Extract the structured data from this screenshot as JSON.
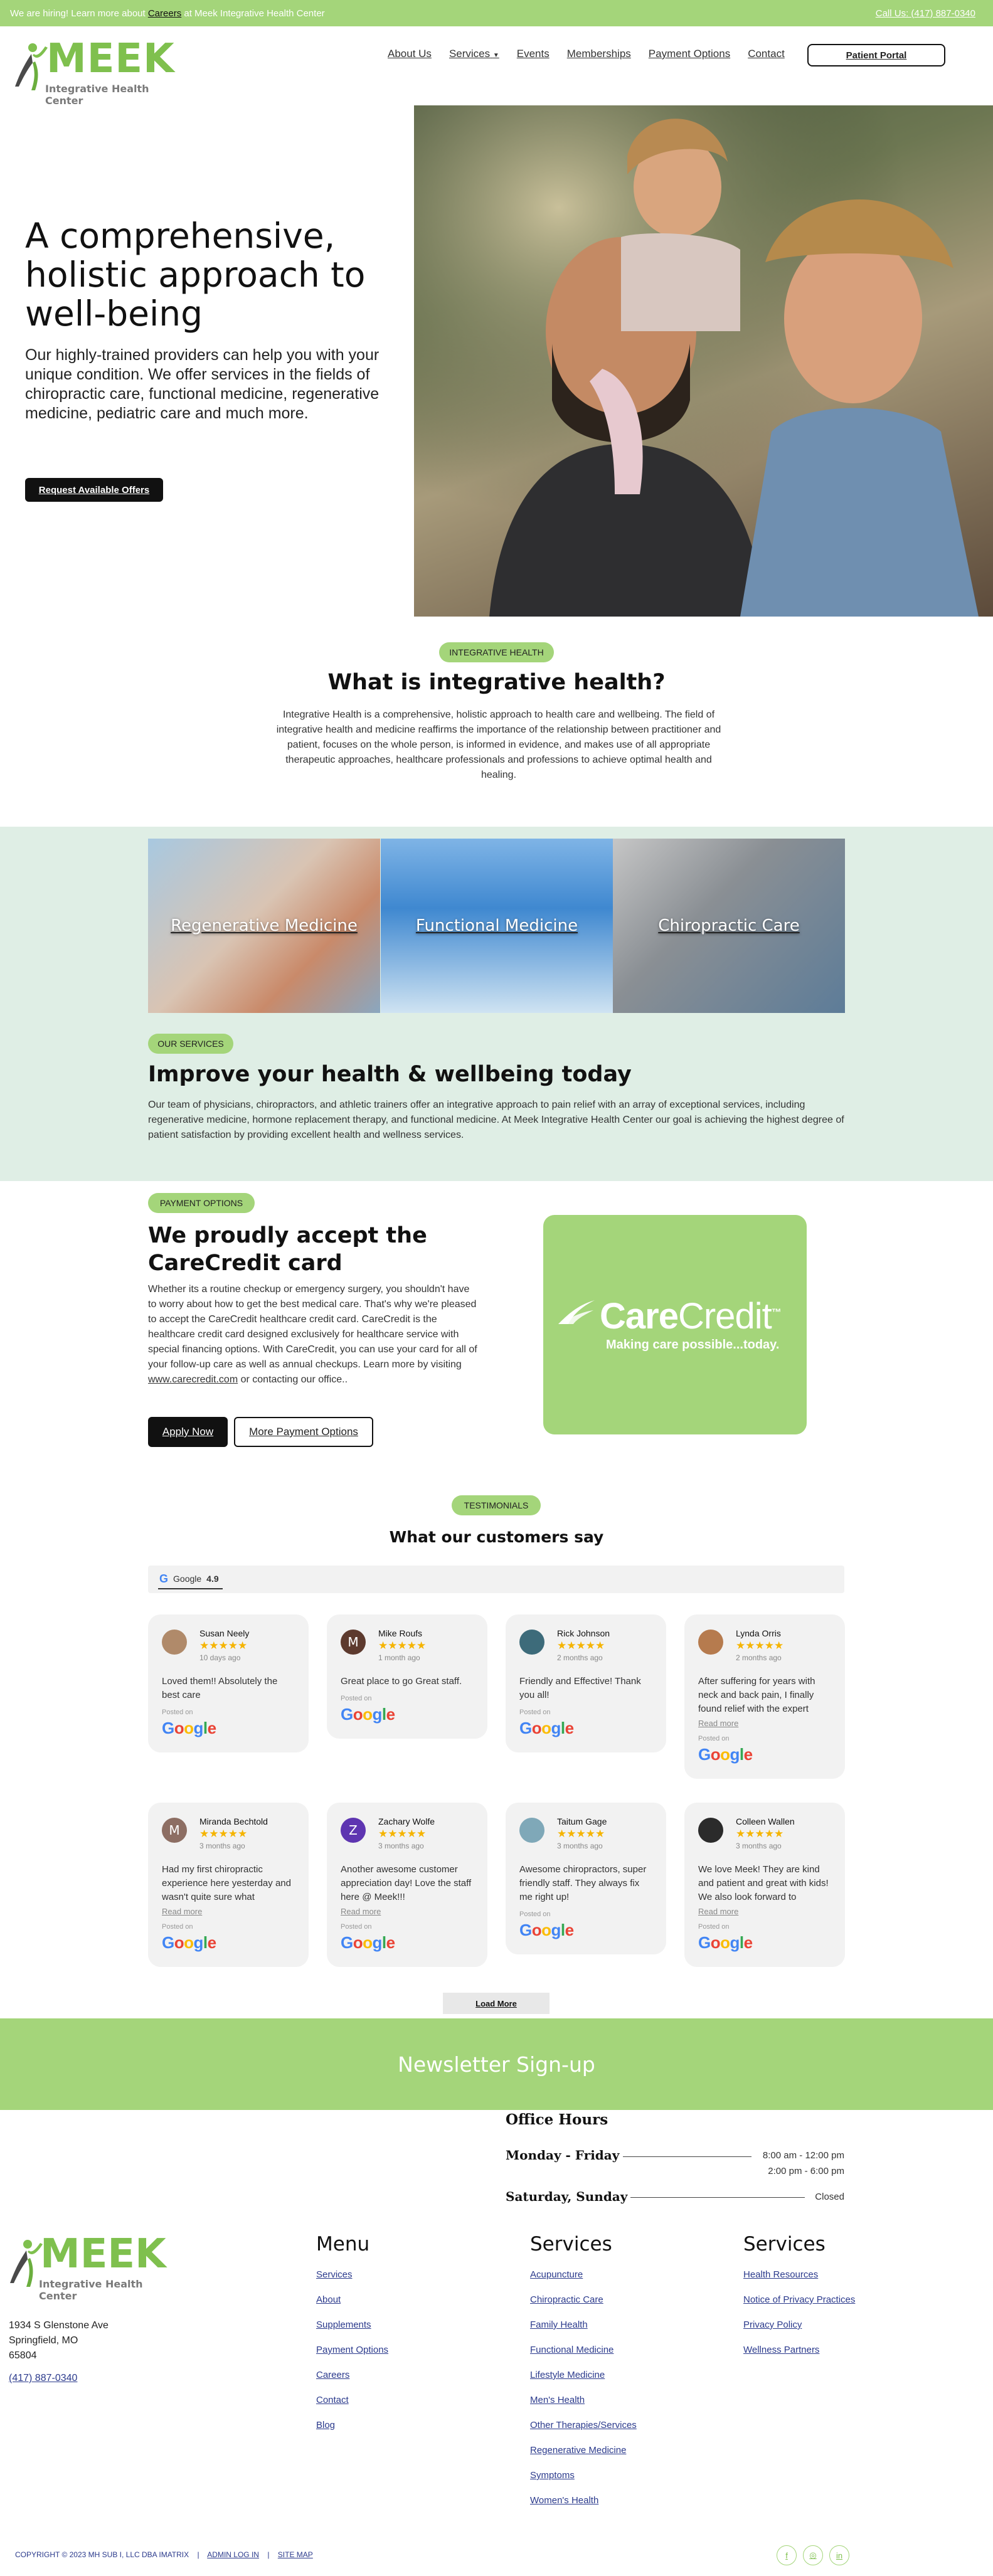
{
  "topbar": {
    "hiring_prefix": "We are hiring! Learn more about ",
    "careers_link": "Careers",
    "hiring_suffix": " at Meek Integrative Health Center",
    "call": "Call Us: (417) 887-0340"
  },
  "logo": {
    "word": "MEEK",
    "sub": "Integrative Health Center"
  },
  "nav": {
    "items": [
      "About Us",
      "Services",
      "Events",
      "Memberships",
      "Payment Options",
      "Contact"
    ],
    "portal": "Patient Portal"
  },
  "hero": {
    "title": "A comprehensive, holistic approach to well-being",
    "subtitle": "Our highly-trained providers can help you with your unique condition. We offer services in the fields of chiropractic care, functional medicine, regenerative medicine, pediatric care and much more.",
    "button": "Request Available Offers"
  },
  "intro": {
    "pill": "INTEGRATIVE HEALTH",
    "title": "What is integrative health?",
    "body": "Integrative Health is a comprehensive, holistic approach to health care and wellbeing.  The field of integrative health and medicine reaffirms the importance of the relationship between practitioner and patient, focuses on the whole person, is informed in evidence, and makes use of all appropriate therapeutic approaches, healthcare professionals and professions to achieve optimal health and healing."
  },
  "services": {
    "cards": [
      "Regenerative Medicine",
      "Functional Medicine",
      "Chiropractic Care"
    ],
    "pill": "OUR SERVICES",
    "title": "Improve your health & wellbeing today",
    "body": "Our team of physicians, chiropractors, and athletic trainers offer an integrative approach to pain relief with an array of exceptional services, including regenerative medicine, hormone replacement therapy, and functional medicine. At Meek Integrative Health Center our goal is achieving the highest degree of patient satisfaction by providing excellent health and wellness services."
  },
  "payment": {
    "pill": "PAYMENT OPTIONS",
    "title": "We proudly accept the CareCredit card",
    "body": "Whether its a routine checkup or emergency surgery, you shouldn't have to worry about how to get the best medical care. That's why we're pleased to accept the CareCredit healthcare credit card. CareCredit is the healthcare credit card designed exclusively for healthcare service with special financing options. With CareCredit, you can use your card for all of your follow-up care as well as annual checkups. Learn more by visiting ",
    "link": "www.carecredit.com",
    "body_end": " or contacting our office..",
    "apply": "Apply Now",
    "more": "More Payment Options",
    "cc_word_bold": "Care",
    "cc_word_light": "Credit",
    "cc_tm": "™",
    "cc_tag": "Making care possible...today."
  },
  "testimonials": {
    "pill": "TESTIMONIALS",
    "title": "What our customers say",
    "google_label": "Google",
    "google_rating": "4.9",
    "stars": "★★★★★",
    "posted_on": "Posted on",
    "read_more": "Read more",
    "reviews": [
      {
        "name": "Susan Neely",
        "when": "10 days ago",
        "text": "Loved them!! Absolutely the best care",
        "initial": "",
        "color": "#b08a6a"
      },
      {
        "name": "Mike Roufs",
        "when": "1 month ago",
        "text": "Great place to go Great staff.",
        "initial": "M",
        "color": "#5d3a2e"
      },
      {
        "name": "Rick Johnson",
        "when": "2 months ago",
        "text": "Friendly and Effective! Thank you all!",
        "initial": "",
        "color": "#3d6b7a"
      },
      {
        "name": "Lynda Orris",
        "when": "2 months ago",
        "text": "After suffering for years with neck and back pain, I finally found relief with the expert",
        "initial": "",
        "color": "#b67b4e"
      },
      {
        "name": "Miranda Bechtold",
        "when": "3 months ago",
        "text": "Had my first chiropractic experience here yesterday and wasn't quite sure what",
        "initial": "M",
        "color": "#8d6e63"
      },
      {
        "name": "Zachary Wolfe",
        "when": "3 months ago",
        "text": "Another awesome customer appreciation day! Love the staff here @ Meek!!!",
        "initial": "Z",
        "color": "#5e35b1"
      },
      {
        "name": "Taitum Gage",
        "when": "3 months ago",
        "text": "Awesome chiropractors, super friendly staff. They always fix me right up!",
        "initial": "",
        "color": "#7fa8b8"
      },
      {
        "name": "Colleen Wallen",
        "when": "3 months ago",
        "text": "We love Meek! They are kind and patient and great with kids! We also look forward to",
        "initial": "",
        "color": "#2b2b2b"
      }
    ],
    "load_more": "Load More"
  },
  "newsletter": {
    "title": "Newsletter Sign-up"
  },
  "office_hours": {
    "title": "Office Hours",
    "rows": [
      {
        "day": "Monday - Friday",
        "times": [
          "8:00 am - 12:00 pm",
          "2:00 pm - 6:00 pm"
        ]
      },
      {
        "day": "Saturday, Sunday",
        "times": [
          "Closed"
        ]
      }
    ]
  },
  "footer": {
    "address": [
      "1934 S Glenstone Ave",
      "Springfield, MO",
      "65804"
    ],
    "phone": "(417) 887-0340",
    "menu_title": "Menu",
    "menu": [
      "Services",
      "About",
      "Supplements",
      "Payment Options",
      "Careers",
      "Contact",
      "Blog"
    ],
    "services_title": "Services",
    "services": [
      "Acupuncture",
      "Chiropractic Care",
      "Family Health",
      "Functional Medicine",
      "Lifestyle Medicine",
      "Men's Health",
      "Other Therapies/Services",
      "Regenerative Medicine",
      "Symptoms",
      "Women's Health"
    ],
    "services2_title": "Services",
    "services2": [
      "Health Resources",
      "Notice of Privacy Practices",
      "Privacy Policy",
      "Wellness Partners"
    ],
    "copyright": "COPYRIGHT © 2023 MH SUB I, LLC DBA IMATRIX",
    "admin": "ADMIN LOG IN",
    "sitemap": "SITE MAP",
    "sep": "|",
    "social": [
      "f",
      "◎",
      "in"
    ]
  }
}
